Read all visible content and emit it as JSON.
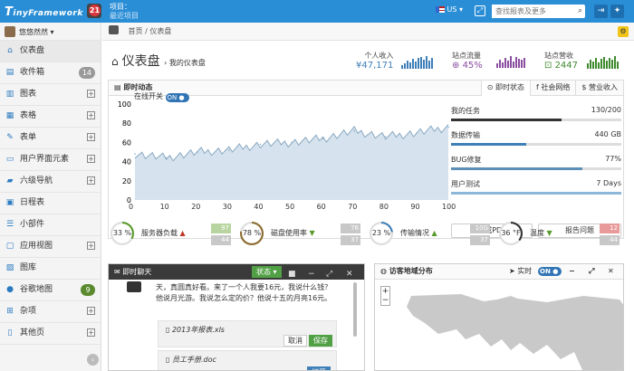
{
  "topbar": {
    "logo_initial": "T",
    "logo_rest": "inyFramework",
    "notifications": "21",
    "project_label": "项目：",
    "project_name": "最近项目",
    "lang": "US",
    "search_placeholder": "查找报表及更多"
  },
  "user": {
    "name": "悠悠然然"
  },
  "sidebar": {
    "items": [
      {
        "label": "仪表盘",
        "icon": "home-icon"
      },
      {
        "label": "收件箱",
        "icon": "inbox-icon",
        "count": "14"
      },
      {
        "label": "图表",
        "icon": "chart-icon"
      },
      {
        "label": "表格",
        "icon": "table-icon"
      },
      {
        "label": "表单",
        "icon": "form-icon"
      },
      {
        "label": "用户界面元素",
        "icon": "monitor-icon"
      },
      {
        "label": "六级导航",
        "icon": "folder-icon"
      },
      {
        "label": "日程表",
        "icon": "calendar-icon"
      },
      {
        "label": "小部件",
        "icon": "list-icon"
      },
      {
        "label": "应用视图",
        "icon": "app-icon"
      },
      {
        "label": "图库",
        "icon": "image-icon"
      },
      {
        "label": "谷歌地图",
        "icon": "map-marker-icon",
        "count": "9"
      },
      {
        "label": "杂项",
        "icon": "windows-icon"
      },
      {
        "label": "其他页",
        "icon": "file-icon"
      }
    ]
  },
  "breadcrumb": {
    "home": "首页",
    "sep": "/",
    "current": "仪表盘"
  },
  "page": {
    "title": "仪表盘",
    "subtitle": "› 我的仪表盘"
  },
  "stats": [
    {
      "label": "个人收入",
      "value": "¥47,171",
      "color": "#3f7fb8"
    },
    {
      "label": "站点流量",
      "value": "45%",
      "color": "#8a4ea0"
    },
    {
      "label": "站点营收",
      "value": "2447",
      "color": "#3f8a2e"
    }
  ],
  "realtime": {
    "title": "即时动态",
    "tabs": [
      "即时状态",
      "社会网络",
      "营业收入"
    ],
    "online_label": "在线开关",
    "toggle": "ON",
    "chart_data": {
      "type": "area",
      "x": [
        0,
        10,
        20,
        30,
        40,
        50,
        60,
        70,
        80,
        90,
        100
      ],
      "y": [
        48,
        44,
        50,
        52,
        58,
        60,
        64,
        72,
        66,
        70,
        76
      ],
      "ylim": [
        0,
        100
      ],
      "xlim": [
        0,
        100
      ],
      "xticks": [
        "0",
        "10",
        "20",
        "30",
        "40",
        "50",
        "60",
        "70",
        "80",
        "90",
        "100"
      ],
      "yticks": [
        "0",
        "10",
        "20",
        "30",
        "40",
        "50",
        "60",
        "70",
        "80",
        "90",
        "100"
      ]
    }
  },
  "tasks": [
    {
      "label": "我的任务",
      "value": "130/200",
      "pct": 65,
      "color": "#333"
    },
    {
      "label": "数据传输",
      "value": "440 GB",
      "pct": 44,
      "color": "#3f7fb8"
    },
    {
      "label": "BUG修复",
      "value": "77%",
      "pct": 77,
      "color": "#5a8fb8"
    },
    {
      "label": "用户测试",
      "value": "7 Days",
      "pct": 100,
      "color": "#8cb7d8"
    }
  ],
  "task_buttons": {
    "generate": "生成PDF",
    "report": "报告问题"
  },
  "gauges": [
    {
      "value": "33 %",
      "label": "服务器负载",
      "trend": "▲",
      "a": "97",
      "b": "44",
      "color": "#5a9a2e",
      "pct": 33
    },
    {
      "value": "78 %",
      "label": "磁盘使用率",
      "trend": "▼",
      "a": "76",
      "b": "37",
      "color": "#8a6b2e",
      "pct": 78
    },
    {
      "value": "23 %",
      "label": "传输情况",
      "trend": "▲",
      "a": "10G",
      "b": "37",
      "color": "#3f7fb8",
      "pct": 23
    },
    {
      "value": "36 °F",
      "label": "温度",
      "trend": "▼",
      "a": "12",
      "b": "44",
      "color": "#333333",
      "pct": 36
    }
  ],
  "chat": {
    "title": "即时聊天",
    "state": "状态",
    "message": "天，真圆真好看。来了一个人我要16元，我说什么钱？他说月光游。我说怎么定的价？他说十五的月亮16元。",
    "files": [
      {
        "name": "2013年报表.xls",
        "cancel": "取消",
        "save": "保存"
      },
      {
        "name": "员工手册.doc",
        "open": "打开"
      }
    ]
  },
  "map": {
    "title": "访客地域分布",
    "realtime": "实时",
    "toggle": "ON",
    "zoom_in": "+",
    "zoom_out": "−"
  }
}
